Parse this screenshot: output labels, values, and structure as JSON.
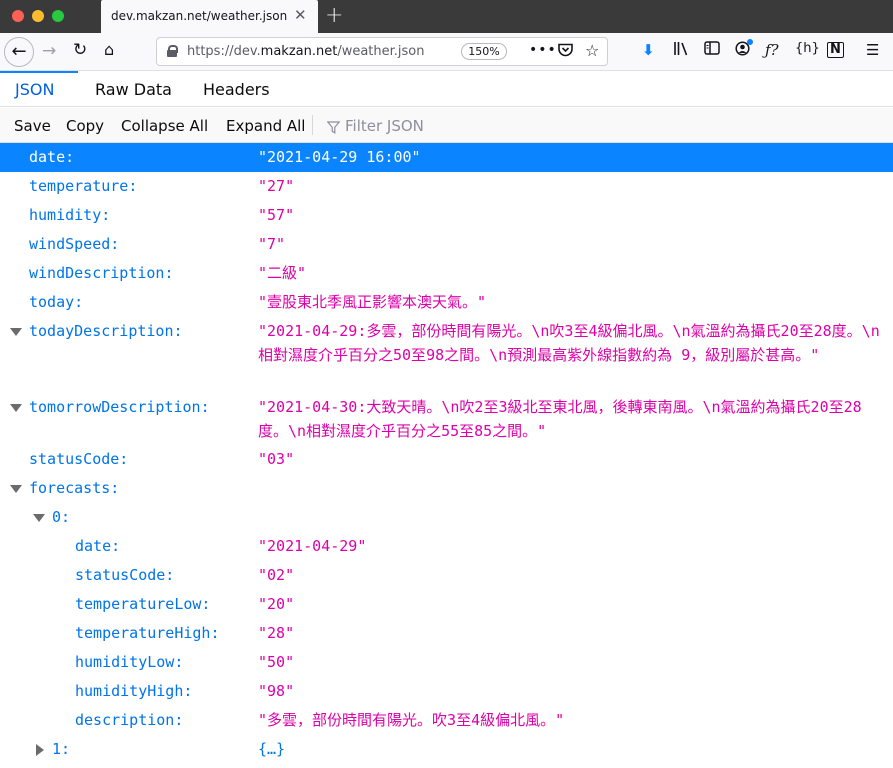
{
  "browser": {
    "tab_title": "dev.makzan.net/weather.json",
    "url_prefix": "https://dev.",
    "url_domain": "makzan.net",
    "url_path": "/weather.json",
    "zoom": "150%",
    "page_actions_label": "•••"
  },
  "viewer": {
    "tabs": [
      "JSON",
      "Raw Data",
      "Headers"
    ],
    "actions": [
      "Save",
      "Copy",
      "Collapse All",
      "Expand All"
    ],
    "filter_placeholder": "Filter JSON"
  },
  "json": {
    "date": {
      "key": "date:",
      "value": "\"2021-04-29 16:00\""
    },
    "temperature": {
      "key": "temperature:",
      "value": "\"27\""
    },
    "humidity": {
      "key": "humidity:",
      "value": "\"57\""
    },
    "windSpeed": {
      "key": "windSpeed:",
      "value": "\"7\""
    },
    "windDescription": {
      "key": "windDescription:",
      "value": "\"二級\""
    },
    "today": {
      "key": "today:",
      "value": "\"壹股東北季風正影響本澳天氣。\""
    },
    "todayDescription": {
      "key": "todayDescription:",
      "value": "\"2021-04-29:多雲，部份時間有陽光。\\n吹3至4級偏北風。\\n氣溫約為攝氏20至28度。\\n相對濕度介乎百分之50至98之間。\\n預測最高紫外線指數約為 9，級別屬於甚高。\""
    },
    "tomorrowDescription": {
      "key": "tomorrowDescription:",
      "value": "\"2021-04-30:大致天晴。\\n吹2至3級北至東北風，後轉東南風。\\n氣溫約為攝氏20至28度。\\n相對濕度介乎百分之55至85之間。\""
    },
    "statusCode": {
      "key": "statusCode:",
      "value": "\"03\""
    },
    "forecasts": {
      "key": "forecasts:"
    },
    "forecast0": {
      "key": "0:",
      "date": {
        "key": "date:",
        "value": "\"2021-04-29\""
      },
      "statusCode": {
        "key": "statusCode:",
        "value": "\"02\""
      },
      "temperatureLow": {
        "key": "temperatureLow:",
        "value": "\"20\""
      },
      "temperatureHigh": {
        "key": "temperatureHigh:",
        "value": "\"28\""
      },
      "humidityLow": {
        "key": "humidityLow:",
        "value": "\"50\""
      },
      "humidityHigh": {
        "key": "humidityHigh:",
        "value": "\"98\""
      },
      "description": {
        "key": "description:",
        "value": "\"多雲，部份時間有陽光。吹3至4級偏北風。\""
      }
    },
    "forecast1": {
      "key": "1:",
      "value": "{…}"
    }
  }
}
